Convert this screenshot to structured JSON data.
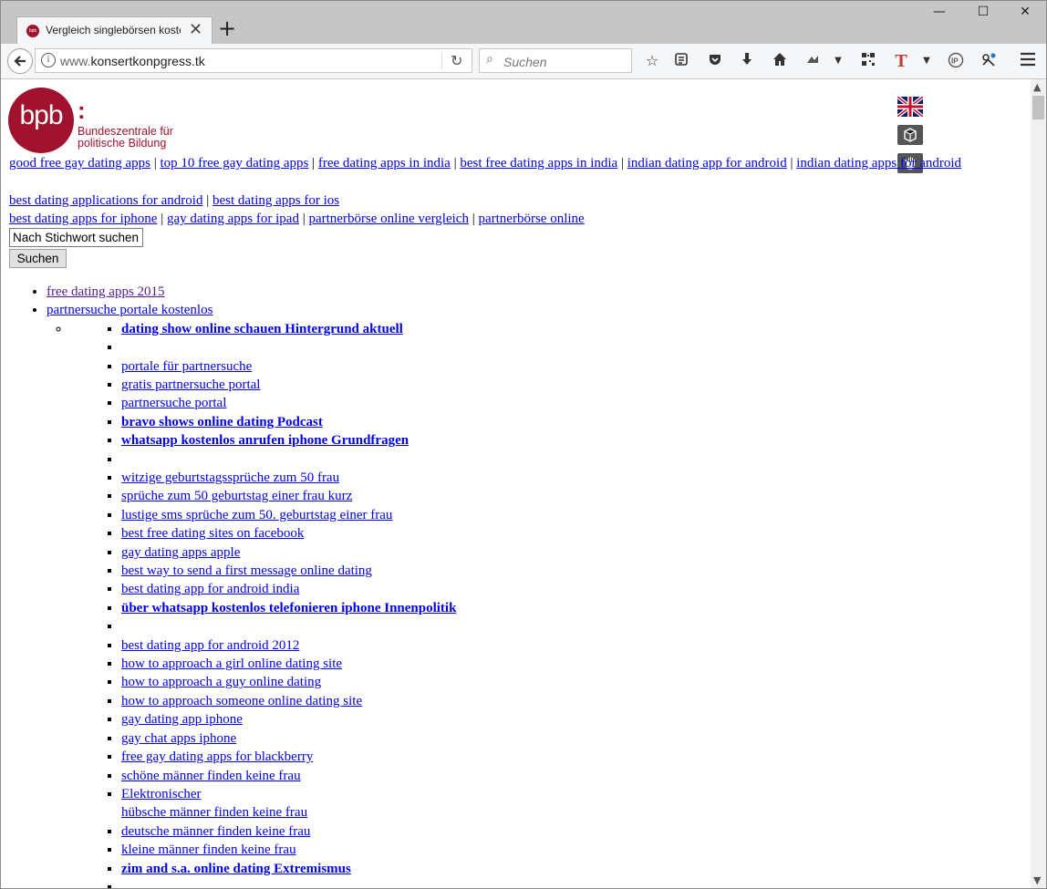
{
  "browser": {
    "tab_title": "Vergleich singlebörsen kostenlos",
    "favicon_text": "bpb",
    "url_prefix": "www.",
    "url_domain": "konsertkonpgress.tk",
    "search_placeholder": "Suchen",
    "window_controls": [
      "—",
      "☐",
      "✕"
    ]
  },
  "header": {
    "logo_text": "bpb",
    "logo_colon": ":",
    "logo_line1": "Bundeszentrale für",
    "logo_line2": "politische Bildung"
  },
  "top_links": {
    "row1": [
      "good free gay dating apps",
      "top 10 free gay dating apps",
      "free dating apps in india",
      "best free dating apps in india",
      "indian dating app for android",
      "indian dating apps for android"
    ],
    "row2": [
      "best dating applications for android",
      "best dating apps for ios"
    ],
    "row3": [
      "best dating apps for iphone",
      "gay dating apps for ipad",
      "partnerbörse online vergleich",
      "partnerbörse online"
    ],
    "separator": "|"
  },
  "search": {
    "input_value": "Nach Stichwort suchen",
    "button_label": "Suchen"
  },
  "list": {
    "top_items": [
      "free dating apps 2015",
      "partnersuche portale kostenlos"
    ],
    "sub_items": [
      {
        "text": "dating show online schauen Hintergrund aktuell",
        "bold": true
      },
      {
        "text": "",
        "bold": false
      },
      {
        "text": "portale für partnersuche",
        "bold": false
      },
      {
        "text": "gratis partnersuche portal",
        "bold": false
      },
      {
        "text": "partnersuche portal",
        "bold": false
      },
      {
        "text": "bravo shows online dating Podcast",
        "bold": true
      },
      {
        "text": "whatsapp kostenlos anrufen iphone Grundfragen",
        "bold": true
      },
      {
        "text": "",
        "bold": false
      },
      {
        "text": "witzige geburtstagssprüche zum 50 frau",
        "bold": false
      },
      {
        "text": "sprüche zum 50 geburtstag einer frau kurz",
        "bold": false
      },
      {
        "text": "lustige sms sprüche zum 50. geburtstag einer frau",
        "bold": false
      },
      {
        "text": "best free dating sites on facebook",
        "bold": false
      },
      {
        "text": "gay dating apps apple",
        "bold": false
      },
      {
        "text": "best way to send a first message online dating",
        "bold": false
      },
      {
        "text": "best dating app for android india",
        "bold": false
      },
      {
        "text": "über whatsapp kostenlos telefonieren iphone Innenpolitik",
        "bold": true
      },
      {
        "text": "",
        "bold": false
      },
      {
        "text": "best dating app for android 2012",
        "bold": false
      },
      {
        "text": "how to approach a girl online dating site",
        "bold": false
      },
      {
        "text": "how to approach a guy online dating",
        "bold": false
      },
      {
        "text": "how to approach someone online dating site",
        "bold": false
      },
      {
        "text": "gay dating app iphone",
        "bold": false
      },
      {
        "text": "gay chat apps iphone",
        "bold": false
      },
      {
        "text": "free gay dating apps for blackberry",
        "bold": false
      },
      {
        "text": "schöne männer finden keine frau",
        "bold": false
      },
      {
        "text": "Elektronischer",
        "bold": false,
        "extra": "hübsche männer finden keine frau"
      },
      {
        "text": "deutsche männer finden keine frau",
        "bold": false
      },
      {
        "text": "kleine männer finden keine frau",
        "bold": false
      },
      {
        "text": "zim and s.a. online dating Extremismus",
        "bold": true
      },
      {
        "text": "",
        "bold": false
      }
    ]
  }
}
